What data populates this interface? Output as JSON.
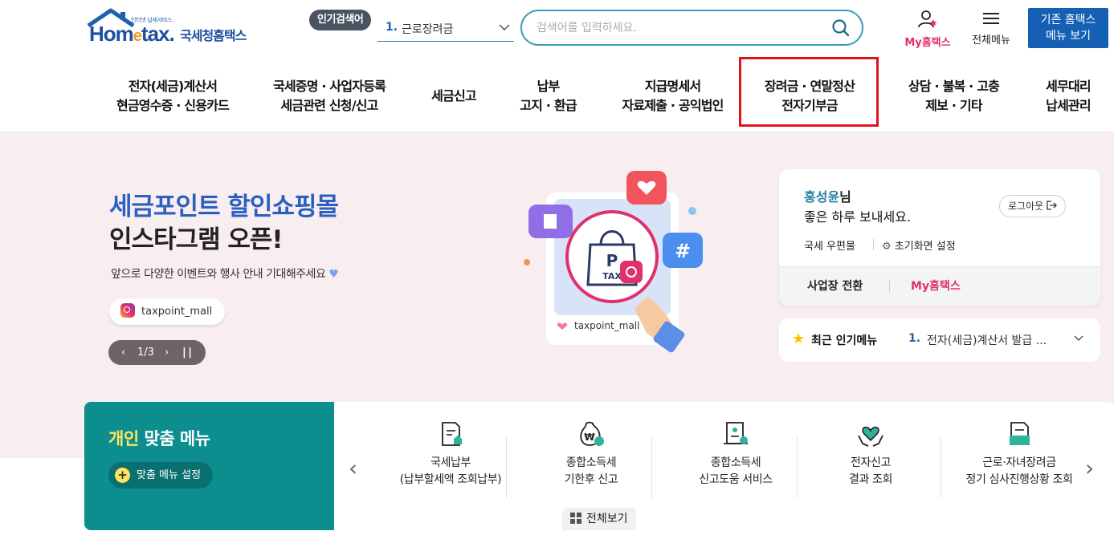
{
  "header": {
    "logo_small": "인터넷 납세서비스",
    "logo_main": "Hometax.",
    "logo_ko": "국세청홈택스",
    "popular_badge": "인기검색어",
    "popular_num": "1.",
    "popular_term": "근로장려금",
    "search_placeholder": "검색어를 입력하세요.",
    "my_hometax": "My홈택스",
    "all_menu": "전체메뉴",
    "old_home_line1": "기존 홈택스",
    "old_home_line2": "메뉴 보기"
  },
  "nav": [
    {
      "line1": "전자(세금)계산서",
      "line2": "현금영수증 · 신용카드"
    },
    {
      "line1": "국세증명 · 사업자등록",
      "line2": "세금관련 신청/신고"
    },
    {
      "line1": "세금신고",
      "line2": ""
    },
    {
      "line1": "납부",
      "line2": "고지 · 환급"
    },
    {
      "line1": "지급명세서",
      "line2": "자료제출 · 공익법인"
    },
    {
      "line1": "장려금 · 연말정산",
      "line2": "전자기부금"
    },
    {
      "line1": "상담 · 불복 · 고충",
      "line2": "제보 · 기타"
    },
    {
      "line1": "세무대리",
      "line2": "납세관리"
    }
  ],
  "banner": {
    "title1": "세금포인트 할인쇼핑몰",
    "title2": "인스타그램 오픈!",
    "subtitle": "앞으로 다양한 이벤트와 행사 안내 기대해주세요",
    "tag": "taxpoint_mall",
    "pager_count": "1/3",
    "illus_tag": "taxpoint_mall",
    "illus_bag_letter": "P",
    "illus_bag_text": "TAX"
  },
  "user_card": {
    "name": "홍성윤",
    "name_suffix": "님",
    "greeting": "좋은 하루 보내세요.",
    "logout": "로그아웃",
    "mailbox": "국세 우편물",
    "initial_settings": "초기화면 설정",
    "switch_business": "사업장 전환",
    "my_hometax": "My홈택스"
  },
  "recent": {
    "title": "최근 인기메뉴",
    "num": "1.",
    "item": "전자(세금)계산서 발급 ..."
  },
  "custom_menu": {
    "title_hl": "개인",
    "title_rest": " 맞춤 메뉴",
    "settings": "맞춤 메뉴 설정",
    "view_all": "전체보기",
    "items": [
      {
        "line1": "국세납부",
        "line2": "(납부할세액 조회납부)",
        "icon": "tax-payment-icon"
      },
      {
        "line1": "종합소득세",
        "line2": "기한후 신고",
        "icon": "income-tax-late-filing-icon"
      },
      {
        "line1": "종합소득세",
        "line2": "신고도움 서비스",
        "icon": "income-tax-help-icon"
      },
      {
        "line1": "전자신고",
        "line2": "결과 조회",
        "icon": "e-filing-result-icon"
      },
      {
        "line1": "근로·자녀장려금",
        "line2": "정기 심사진행상황 조회",
        "icon": "incentive-review-icon"
      }
    ]
  },
  "colors": {
    "brand_blue": "#1f4fa0",
    "accent_pink": "#e0326b",
    "teal": "#0c8e8f",
    "highlight_red": "#e0141e"
  }
}
